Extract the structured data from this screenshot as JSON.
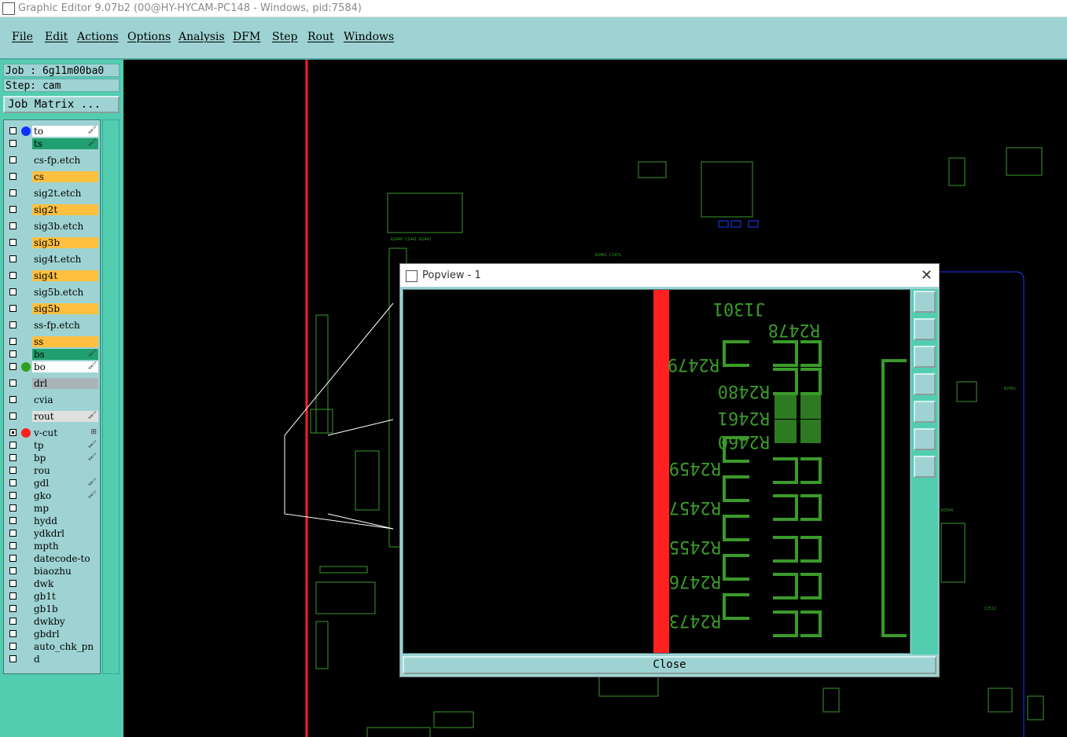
{
  "app": {
    "title": "Graphic Editor 9.07b2 (00@HY-HYCAM-PC148 - Windows, pid:7584)"
  },
  "menu": [
    "File",
    "Edit",
    "Actions",
    "Options",
    "Analysis",
    "DFM",
    "Step",
    "Rout",
    "Windows"
  ],
  "job": {
    "job_label": "Job : 6g11m00ba0",
    "step_label": "Step: cam",
    "matrix_button": "Job Matrix ..."
  },
  "layers": [
    {
      "name": "to",
      "color": "#ffffff",
      "dot": "#1030ff",
      "checked": false,
      "mark": "🖌"
    },
    {
      "name": "ts",
      "color": "#20a070",
      "dot": "",
      "checked": false,
      "mark": "🖌"
    },
    {
      "name": "cs-fp.etch",
      "color": "#9fd3d3",
      "dot": "",
      "checked": false,
      "mark": ""
    },
    {
      "name": "cs",
      "color": "#ffc040",
      "dot": "",
      "checked": false,
      "mark": ""
    },
    {
      "name": "sig2t.etch",
      "color": "#9fd3d3",
      "dot": "",
      "checked": false,
      "mark": ""
    },
    {
      "name": "sig2t",
      "color": "#ffc040",
      "dot": "",
      "checked": false,
      "mark": ""
    },
    {
      "name": "sig3b.etch",
      "color": "#9fd3d3",
      "dot": "",
      "checked": false,
      "mark": ""
    },
    {
      "name": "sig3b",
      "color": "#ffc040",
      "dot": "",
      "checked": false,
      "mark": ""
    },
    {
      "name": "sig4t.etch",
      "color": "#9fd3d3",
      "dot": "",
      "checked": false,
      "mark": ""
    },
    {
      "name": "sig4t",
      "color": "#ffc040",
      "dot": "",
      "checked": false,
      "mark": ""
    },
    {
      "name": "sig5b.etch",
      "color": "#9fd3d3",
      "dot": "",
      "checked": false,
      "mark": ""
    },
    {
      "name": "sig5b",
      "color": "#ffc040",
      "dot": "",
      "checked": false,
      "mark": ""
    },
    {
      "name": "ss-fp.etch",
      "color": "#9fd3d3",
      "dot": "",
      "checked": false,
      "mark": ""
    },
    {
      "name": "ss",
      "color": "#ffc040",
      "dot": "",
      "checked": false,
      "mark": ""
    },
    {
      "name": "bs",
      "color": "#20a070",
      "dot": "",
      "checked": false,
      "mark": "🖌"
    },
    {
      "name": "bo",
      "color": "#ffffff",
      "dot": "#30a020",
      "checked": false,
      "mark": "🖌"
    },
    {
      "name": "drl",
      "color": "#a8b4b8",
      "dot": "",
      "checked": false,
      "mark": ""
    },
    {
      "name": "cvia",
      "color": "#9fd3d3",
      "dot": "",
      "checked": false,
      "mark": ""
    },
    {
      "name": "rout",
      "color": "#e0e0e0",
      "dot": "",
      "checked": false,
      "mark": "🖌"
    },
    {
      "name": "v-cut",
      "color": "#9fd3d3",
      "dot": "#ff2020",
      "checked": true,
      "mark": "⊞"
    },
    {
      "name": "tp",
      "color": "#9fd3d3",
      "dot": "",
      "checked": false,
      "mark": "🖌"
    },
    {
      "name": "bp",
      "color": "#9fd3d3",
      "dot": "",
      "checked": false,
      "mark": "🖌"
    },
    {
      "name": "rou",
      "color": "#9fd3d3",
      "dot": "",
      "checked": false,
      "mark": ""
    },
    {
      "name": "gdl",
      "color": "#9fd3d3",
      "dot": "",
      "checked": false,
      "mark": "🖌"
    },
    {
      "name": "gko",
      "color": "#9fd3d3",
      "dot": "",
      "checked": false,
      "mark": "🖌"
    },
    {
      "name": "mp",
      "color": "#9fd3d3",
      "dot": "",
      "checked": false,
      "mark": ""
    },
    {
      "name": "hydd",
      "color": "#9fd3d3",
      "dot": "",
      "checked": false,
      "mark": ""
    },
    {
      "name": "ydkdrl",
      "color": "#9fd3d3",
      "dot": "",
      "checked": false,
      "mark": ""
    },
    {
      "name": "mpth",
      "color": "#9fd3d3",
      "dot": "",
      "checked": false,
      "mark": ""
    },
    {
      "name": "datecode-to",
      "color": "#9fd3d3",
      "dot": "",
      "checked": false,
      "mark": ""
    },
    {
      "name": "biaozhu",
      "color": "#9fd3d3",
      "dot": "",
      "checked": false,
      "mark": ""
    },
    {
      "name": "dwk",
      "color": "#9fd3d3",
      "dot": "",
      "checked": false,
      "mark": ""
    },
    {
      "name": "gb1t",
      "color": "#9fd3d3",
      "dot": "",
      "checked": false,
      "mark": ""
    },
    {
      "name": "gb1b",
      "color": "#9fd3d3",
      "dot": "",
      "checked": false,
      "mark": ""
    },
    {
      "name": "dwkby",
      "color": "#9fd3d3",
      "dot": "",
      "checked": false,
      "mark": ""
    },
    {
      "name": "gbdrl",
      "color": "#9fd3d3",
      "dot": "",
      "checked": false,
      "mark": ""
    },
    {
      "name": "auto_chk_pn",
      "color": "#9fd3d3",
      "dot": "",
      "checked": false,
      "mark": ""
    },
    {
      "name": "d",
      "color": "#9fd3d3",
      "dot": "",
      "checked": false,
      "mark": ""
    }
  ],
  "popup": {
    "title": "Popview - 1",
    "close_label": "Close",
    "labels": [
      "J1301",
      "R2478",
      "R2479",
      "R2480",
      "R2461",
      "R2460",
      "R2459",
      "R2457",
      "R2455",
      "R2476",
      "R2473"
    ]
  },
  "colors": {
    "accent": "#9fd3d3",
    "panel": "#52cdb0",
    "trace": "#3a9a2a",
    "vcut": "#ff2020"
  }
}
